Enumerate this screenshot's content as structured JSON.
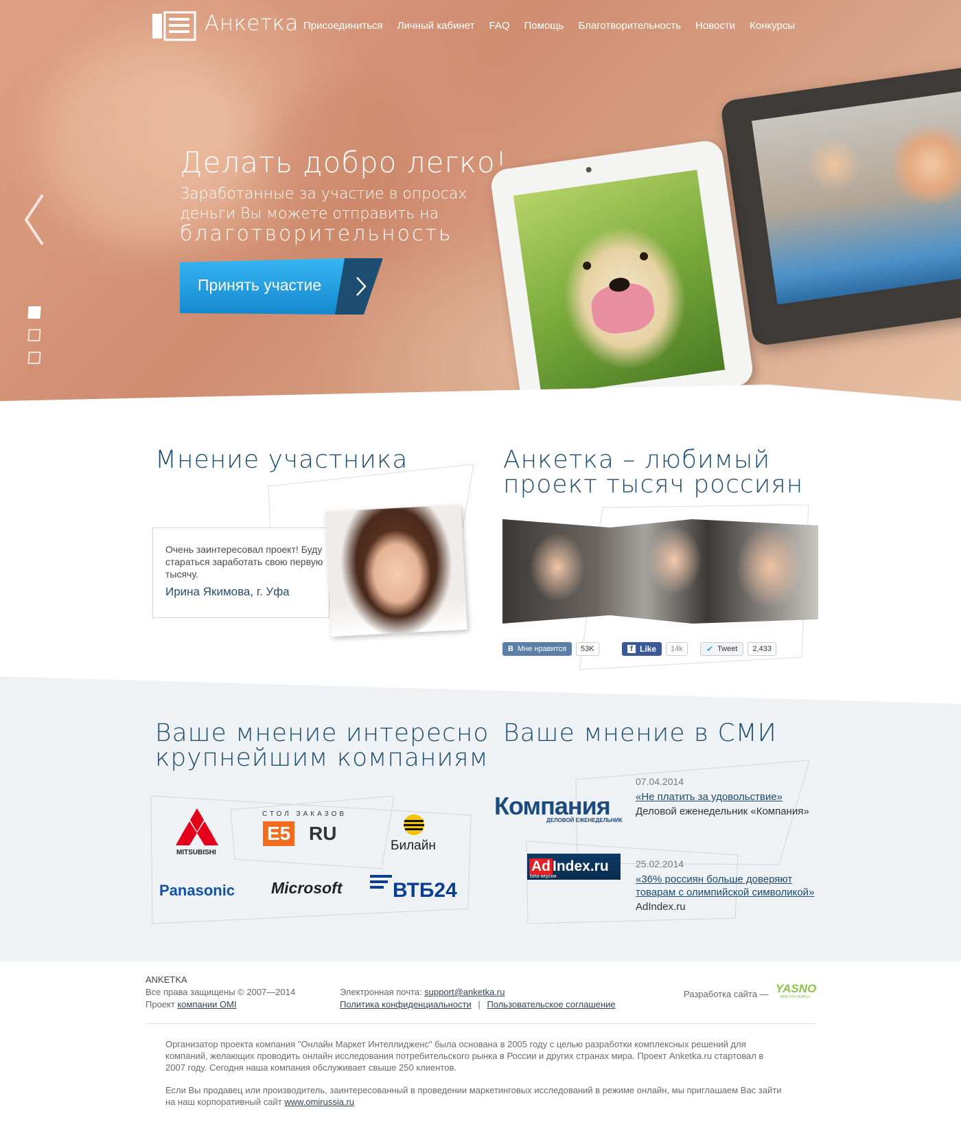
{
  "header": {
    "logo_text": "Анкетка",
    "nav": [
      "Присоединиться",
      "Личный кабинет",
      "FAQ",
      "Помощь",
      "Благотворительность",
      "Новости",
      "Конкурсы"
    ]
  },
  "hero": {
    "title": "Делать добро легко!",
    "subtitle_line1": "Заработанные за участие в опросах",
    "subtitle_line2": "деньги Вы можете отправить на",
    "subtitle_line3": "благотворительность",
    "cta_label": "Принять участие",
    "slides_count": 3,
    "active_slide": 1
  },
  "testimonial": {
    "heading": "Мнение участника",
    "quote": "Очень заинтересовал проект! Буду стараться заработать свою первую тысячу.",
    "author": "Ирина Якимова, г. Уфа"
  },
  "popular": {
    "heading_line1": "Анкетка – любимый",
    "heading_line2": "проект тысяч россиян",
    "social": {
      "vk_label": "Мне нравится",
      "vk_count": "53K",
      "fb_label": "Like",
      "fb_count": "14k",
      "tw_label": "Tweet",
      "tw_count": "2,433"
    }
  },
  "companies": {
    "heading_line1": "Ваше мнение интересно",
    "heading_line2": "крупнейшим компаниям",
    "logos": {
      "mitsubishi": "MITSUBISHI",
      "e5_top": "СТОЛ ЗАКАЗОВ",
      "e5_main": "E5",
      "e5_ru": "RU",
      "beeline": "Билайн",
      "panasonic": "Panasonic",
      "microsoft": "Microsoft",
      "vtb": "ВТБ24"
    }
  },
  "media": {
    "heading": "Ваше мнение в СМИ",
    "items": [
      {
        "logo": "Компания",
        "logo_sub": "ДЕЛОВОЙ ЕЖЕНЕДЕЛЬНИК",
        "date": "07.04.2014",
        "title": "«Не платить за удовольствие»",
        "source": "Деловой еженедельник «Компания»"
      },
      {
        "logo_ad": "Ad",
        "logo_index": "Index.ru",
        "logo_sub": "beta-версия",
        "date": "25.02.2014",
        "title_line1": "«36% россиян больше доверяют",
        "title_line2": "товарам с олимпийской символикой»",
        "source": "AdIndex.ru"
      }
    ]
  },
  "footer": {
    "brand": "ANKETKA",
    "rights": "Все права защищены © 2007—2014",
    "project_prefix": "Проект ",
    "project_link": "компании OMI",
    "email_label": "Электронная почта: ",
    "email": "support@anketka.ru",
    "privacy": "Политика конфиденциальности",
    "separator": "|",
    "agreement": "Пользовательское соглашение",
    "dev_label": "Разработка сайта —",
    "dev_logo": "YASNO",
    "dev_logo_sub": "WEB FOR MOBILE",
    "about1": "Организатор проекта компания \"Онлайн Маркет Интеллидженс\" была основана в 2005 году с целью разработки комплексных решений для компаний, желающих проводить онлайн исследования потребительского рынка в России и других странах мира. Проект Anketka.ru стартовал в 2007 году. Сегодня наша компания обслуживает свыше 250 клиентов.",
    "about2_text": "Если Вы продавец или производитель, заинтересованный в проведении маркетинговых исследований в режиме онлайн, мы приглашаем Вас зайти на наш корпоративный сайт ",
    "about2_link": "www.omirussia.ru"
  },
  "colors": {
    "accent_blue": "#1f4e6e",
    "cta_blue": "#1ba3e6",
    "cta_dark": "#1d5e86",
    "vk": "#5b7fa6",
    "fb": "#3b5998"
  }
}
